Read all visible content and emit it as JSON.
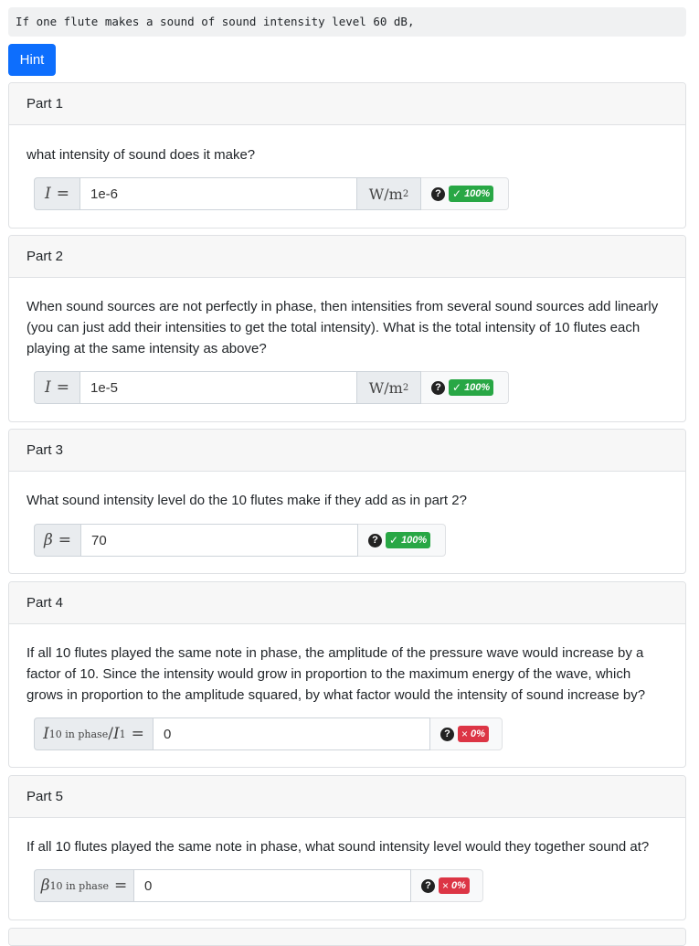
{
  "question": "If one flute makes a sound of sound intensity level 60 dB,",
  "hint_label": "Hint",
  "help_glyph": "?",
  "colors": {
    "primary": "#0d6efd",
    "success": "#28a745",
    "danger": "#dc3545"
  },
  "parts": [
    {
      "title": "Part 1",
      "text": "what intensity of sound does it make?",
      "label_var": "I",
      "label_sub": "",
      "label_eq": "=",
      "value": "1e-6",
      "unit_base": "W/m",
      "unit_sup": "2",
      "status": {
        "icon": "check-icon",
        "glyph": "✓",
        "score": "100%",
        "correct": true
      }
    },
    {
      "title": "Part 2",
      "text": "When sound sources are not perfectly in phase, then intensities from several sound sources add linearly (you can just add their intensities to get the total intensity). What is the total intensity of 10 flutes each playing at the same intensity as above?",
      "label_var": "I",
      "label_sub": "",
      "label_eq": "=",
      "value": "1e-5",
      "unit_base": "W/m",
      "unit_sup": "2",
      "status": {
        "icon": "check-icon",
        "glyph": "✓",
        "score": "100%",
        "correct": true
      }
    },
    {
      "title": "Part 3",
      "text": "What sound intensity level do the 10 flutes make if they add as in part 2?",
      "label_var": "β",
      "label_sub": "",
      "label_eq": "=",
      "value": "70",
      "status": {
        "icon": "check-icon",
        "glyph": "✓",
        "score": "100%",
        "correct": true
      }
    },
    {
      "title": "Part 4",
      "text": "If all 10 flutes played the same note in phase, the amplitude of the pressure wave would increase by a factor of 10. Since the intensity would grow in proportion to the maximum energy of the wave, which grows in proportion to the amplitude squared, by what factor would the intensity of sound increase by?",
      "label_var": "I",
      "label_sub": "10 in phase",
      "label_mid": "/",
      "label_var2": "I",
      "label_sub2": "1",
      "label_eq": "=",
      "value": "0",
      "status": {
        "icon": "x-icon",
        "glyph": "×",
        "score": "0%",
        "correct": false
      }
    },
    {
      "title": "Part 5",
      "text": "If all 10 flutes played the same note in phase, what sound intensity level would they together sound at?",
      "label_var": "β",
      "label_sub": "10 in phase",
      "label_eq": "=",
      "value": "0",
      "status": {
        "icon": "x-icon",
        "glyph": "×",
        "score": "0%",
        "correct": false
      }
    }
  ]
}
